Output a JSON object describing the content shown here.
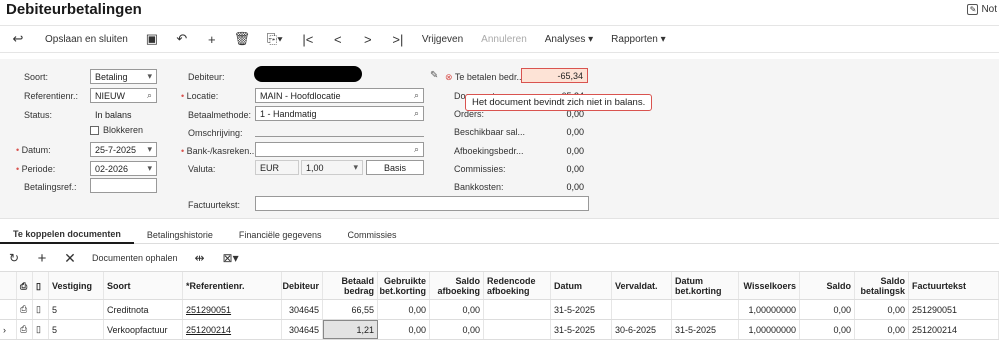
{
  "header": {
    "title": "Debiteurbetalingen",
    "notes_label": "Not"
  },
  "toolbar": {
    "back_icon": "arrow-left-icon",
    "save_close": "Opslaan en sluiten",
    "release": "Vrijgeven",
    "cancel": "Annuleren",
    "analyses": "Analyses",
    "reports": "Rapporten"
  },
  "form": {
    "soort_label": "Soort:",
    "soort_value": "Betaling",
    "ref_label": "Referentienr.:",
    "ref_value": "NIEUW",
    "status_label": "Status:",
    "status_value": "In balans",
    "blokkeren_label": "Blokkeren",
    "datum_label": "Datum:",
    "datum_value": "25-7-2025",
    "periode_label": "Periode:",
    "periode_value": "02-2026",
    "betalingsref_label": "Betalingsref.:",
    "debiteur_label": "Debiteur:",
    "locatie_label": "Locatie:",
    "locatie_value": "MAIN - Hoofdlocatie",
    "betaalmethode_label": "Betaalmethode:",
    "betaalmethode_value": "1 - Handmatig",
    "omschrijving_label": "Omschrijving:",
    "bank_label": "Bank-/kasreken...",
    "valuta_label": "Valuta:",
    "valuta_value": "EUR",
    "rate_value": "1,00",
    "basis_label": "Basis",
    "factuurtekst_label": "Factuurtekst:",
    "te_betalen_label": "Te betalen bedr...",
    "te_betalen_value": "-65,34",
    "documenten_label": "Documenten...",
    "documenten_value": "65,34",
    "orders_label": "Orders:",
    "orders_value": "0,00",
    "beschikbaar_label": "Beschikbaar sal...",
    "beschikbaar_value": "0,00",
    "afboeking_label": "Afboekingsbedr...",
    "afboeking_value": "0,00",
    "commissies_label": "Commissies:",
    "commissies_value": "0,00",
    "bankkosten_label": "Bankkosten:",
    "bankkosten_value": "0,00",
    "tooltip": "Het document bevindt zich niet in balans."
  },
  "tabs": [
    "Te koppelen documenten",
    "Betalingshistorie",
    "Financiële gegevens",
    "Commissies"
  ],
  "gridbar": {
    "fetch_docs": "Documenten ophalen"
  },
  "grid": {
    "headers": {
      "vestiging": "Vestiging",
      "soort": "Soort",
      "refnr": "*Referentienr.",
      "debiteur": "Debiteur",
      "betaald": "Betaald bedrag",
      "gebruikte": "Gebruikte bet.korting",
      "saldo_afb": "Saldo afboeking",
      "redencode": "Redencode afboeking",
      "datum": "Datum",
      "vervaldat": "Vervaldat.",
      "datum_bet": "Datum bet.korting",
      "wisselkoers": "Wisselkoers",
      "saldo": "Saldo",
      "saldo_bet": "Saldo betalingsk",
      "factuurtekst": "Factuurtekst"
    },
    "rows": [
      {
        "vestiging": "5",
        "soort": "Creditnota",
        "refnr": "251290051",
        "debiteur": "304645",
        "betaald": "66,55",
        "gebruikte": "0,00",
        "saldo_afb": "0,00",
        "redencode": "",
        "datum": "31-5-2025",
        "vervaldat": "",
        "datum_bet": "",
        "wisselkoers": "1,00000000",
        "saldo": "0,00",
        "saldo_bet": "0,00",
        "factuurtekst": "251290051"
      },
      {
        "vestiging": "5",
        "soort": "Verkoopfactuur",
        "refnr": "251200214",
        "debiteur": "304645",
        "betaald": "1,21",
        "gebruikte": "0,00",
        "saldo_afb": "0,00",
        "redencode": "",
        "datum": "31-5-2025",
        "vervaldat": "30-6-2025",
        "datum_bet": "31-5-2025",
        "wisselkoers": "1,00000000",
        "saldo": "0,00",
        "saldo_bet": "0,00",
        "factuurtekst": "251200214"
      }
    ]
  }
}
